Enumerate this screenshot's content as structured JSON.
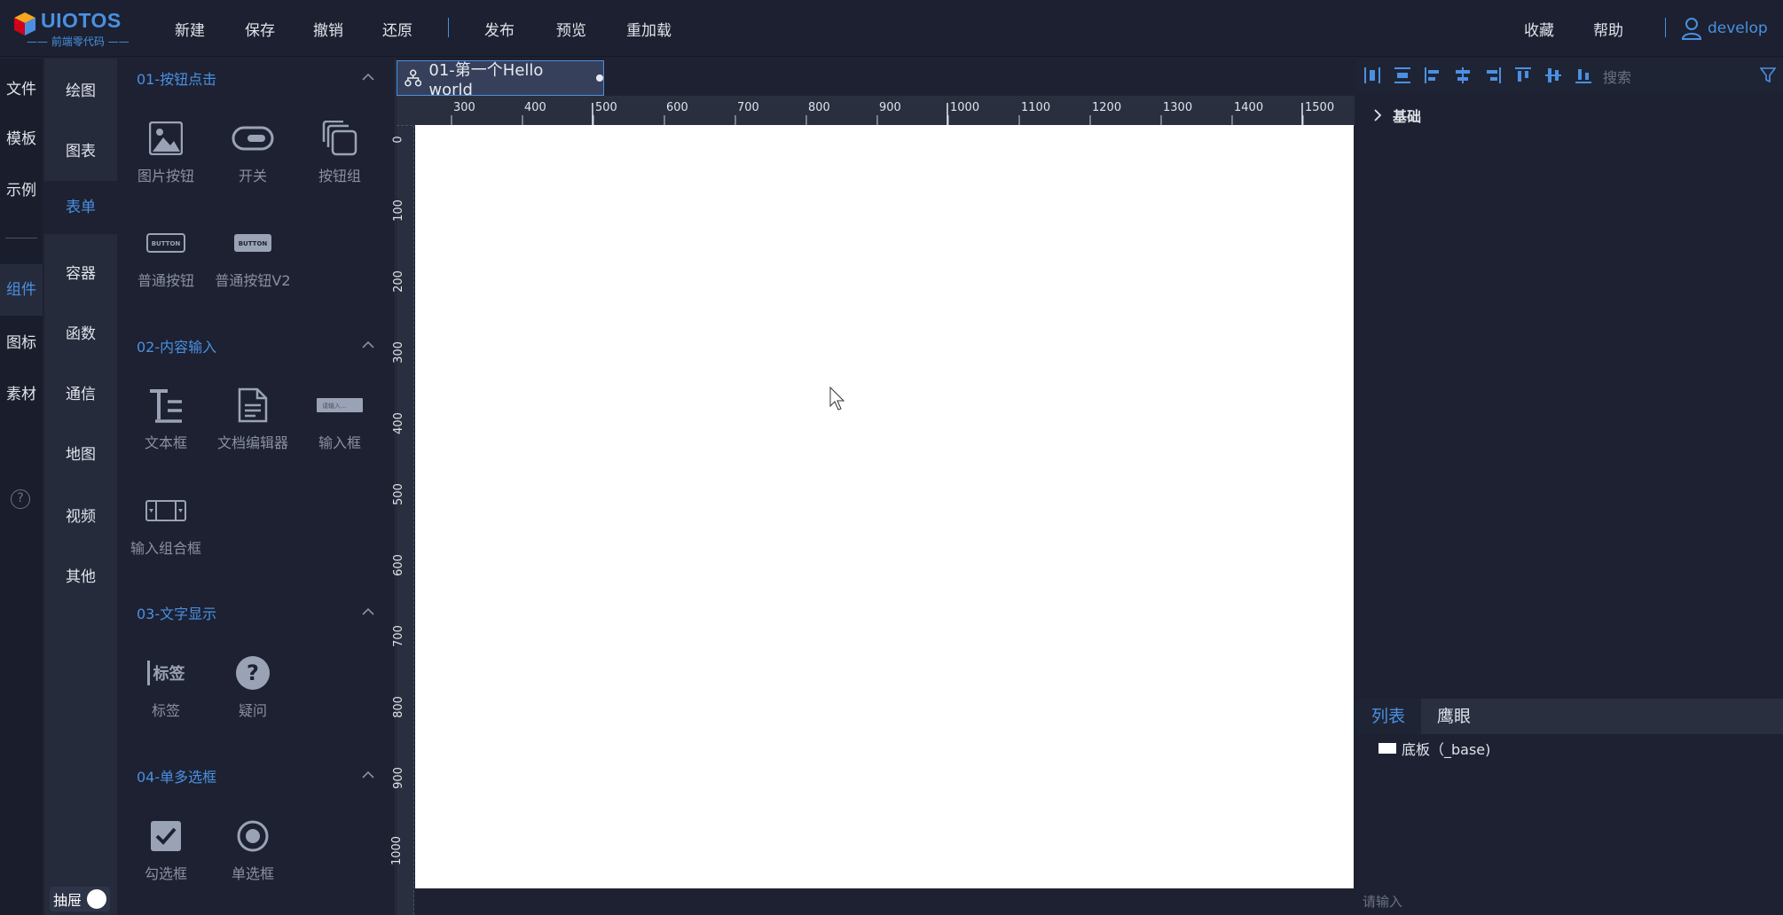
{
  "app": {
    "brand": "UIOTOS",
    "tagline": "—— 前端零代码 ——",
    "colors": {
      "accent": "#4a90e2",
      "background": "#1d2131",
      "canvas": "#ffffff"
    }
  },
  "topmenu": {
    "items": [
      "新建",
      "保存",
      "撤销",
      "还原",
      "发布",
      "预览",
      "重加载"
    ],
    "right": [
      "收藏",
      "帮助"
    ],
    "user": "develop"
  },
  "rail1": {
    "items": [
      "文件",
      "模板",
      "示例",
      "组件",
      "图标",
      "素材"
    ],
    "active": "组件"
  },
  "rail2": {
    "items": [
      "绘图",
      "图表",
      "表单",
      "容器",
      "函数",
      "通信",
      "地图",
      "视频",
      "其他"
    ],
    "active": "表单",
    "drawer_label": "抽屉"
  },
  "panel": {
    "groups": [
      {
        "title": "01-按钮点击",
        "items": [
          "图片按钮",
          "开关",
          "按钮组",
          "普通按钮",
          "普通按钮V2"
        ]
      },
      {
        "title": "02-内容输入",
        "items": [
          "文本框",
          "文档编辑器",
          "输入框",
          "输入组合框"
        ]
      },
      {
        "title": "03-文字显示",
        "items": [
          "标签",
          "疑问"
        ]
      },
      {
        "title": "04-单多选框",
        "items": [
          "勾选框",
          "单选框"
        ]
      }
    ],
    "icon_texts": {
      "button": "BUTTON",
      "label": "标签",
      "input_ph": "请输入..."
    }
  },
  "canvas": {
    "tab_title": "01-第一个Hello world",
    "ruler_x": [
      "300",
      "400",
      "500",
      "600",
      "700",
      "800",
      "900",
      "1000",
      "1100",
      "1200",
      "1300",
      "1400",
      "1500"
    ],
    "ruler_y": [
      "0",
      "100",
      "200",
      "300",
      "400",
      "500",
      "600",
      "700",
      "800",
      "900",
      "1000"
    ]
  },
  "right": {
    "search_placeholder": "搜索",
    "section": "基础",
    "tabs": [
      "列表",
      "鹰眼"
    ],
    "active_tab": "列表",
    "tree_item": "底板（_base)",
    "input_placeholder": "请输入"
  }
}
